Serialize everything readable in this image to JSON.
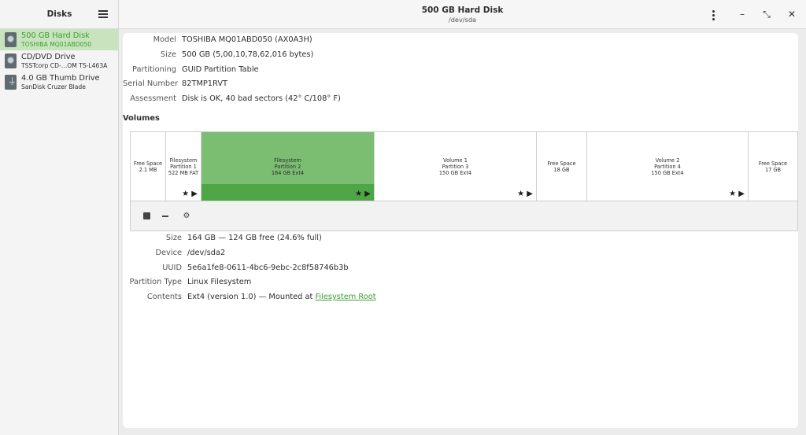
{
  "sidebar": {
    "title": "Disks",
    "disks": [
      {
        "name": "500 GB Hard Disk",
        "sub": "TOSHIBA MQ01ABD050",
        "icon": "hard-disk-icon",
        "selected": true
      },
      {
        "name": "CD/DVD Drive",
        "sub": "TSSTcorp CD-…OM TS-L463A",
        "icon": "optical-drive-icon",
        "selected": false
      },
      {
        "name": "4.0 GB Thumb Drive",
        "sub": "SanDisk Cruzer Blade",
        "icon": "usb-drive-icon",
        "selected": false
      }
    ]
  },
  "header": {
    "title": "500 GB Hard Disk",
    "subtitle": "/dev/sda",
    "buttons": [
      "menu-dots-icon",
      "minimize-icon",
      "restore-icon",
      "close-icon"
    ]
  },
  "disk_info": [
    {
      "label": "Model",
      "value": "TOSHIBA MQ01ABD050 (AX0A3H)"
    },
    {
      "label": "Size",
      "value": "500 GB (5,00,10,78,62,016 bytes)"
    },
    {
      "label": "Partitioning",
      "value": "GUID Partition Table"
    },
    {
      "label": "Serial Number",
      "value": "82TMP1RVT"
    },
    {
      "label": "Assessment",
      "value": "Disk is OK, 40 bad sectors (42° C/108° F)"
    }
  ],
  "volumes_title": "Volumes",
  "volumes": [
    {
      "lines": [
        "Free Space",
        "2.1 MB"
      ],
      "selected": false,
      "icons": false
    },
    {
      "lines": [
        "Filesystem",
        "Partition 1",
        "522 MB FAT"
      ],
      "selected": false,
      "icons": true
    },
    {
      "lines": [
        "Filesystem",
        "Partition 2",
        "164 GB Ext4"
      ],
      "selected": true,
      "icons": true
    },
    {
      "lines": [
        "Volume 1",
        "Partition 3",
        "150 GB Ext4"
      ],
      "selected": false,
      "icons": true
    },
    {
      "lines": [
        "Free Space",
        "18 GB"
      ],
      "selected": false,
      "icons": false
    },
    {
      "lines": [
        "Volume 2",
        "Partition 4",
        "150 GB Ext4"
      ],
      "selected": false,
      "icons": true
    },
    {
      "lines": [
        "Free Space",
        "17 GB"
      ],
      "selected": false,
      "icons": false
    }
  ],
  "volume_icons": "★ ▶",
  "toolbar": [
    "stop-icon",
    "delete-partition-icon",
    "settings-gears-icon"
  ],
  "partition_info": [
    {
      "label": "Size",
      "value": "164 GB — 124 GB free (24.6% full)"
    },
    {
      "label": "Device",
      "value": "/dev/sda2"
    },
    {
      "label": "UUID",
      "value": "5e6a1fe8-0611-4bc6-9ebc-2c8f58746b3b"
    },
    {
      "label": "Partition Type",
      "value": "Linux Filesystem"
    },
    {
      "label": "Contents",
      "value": "Ext4 (version 1.0) — Mounted at ",
      "link": "Filesystem Root"
    }
  ]
}
